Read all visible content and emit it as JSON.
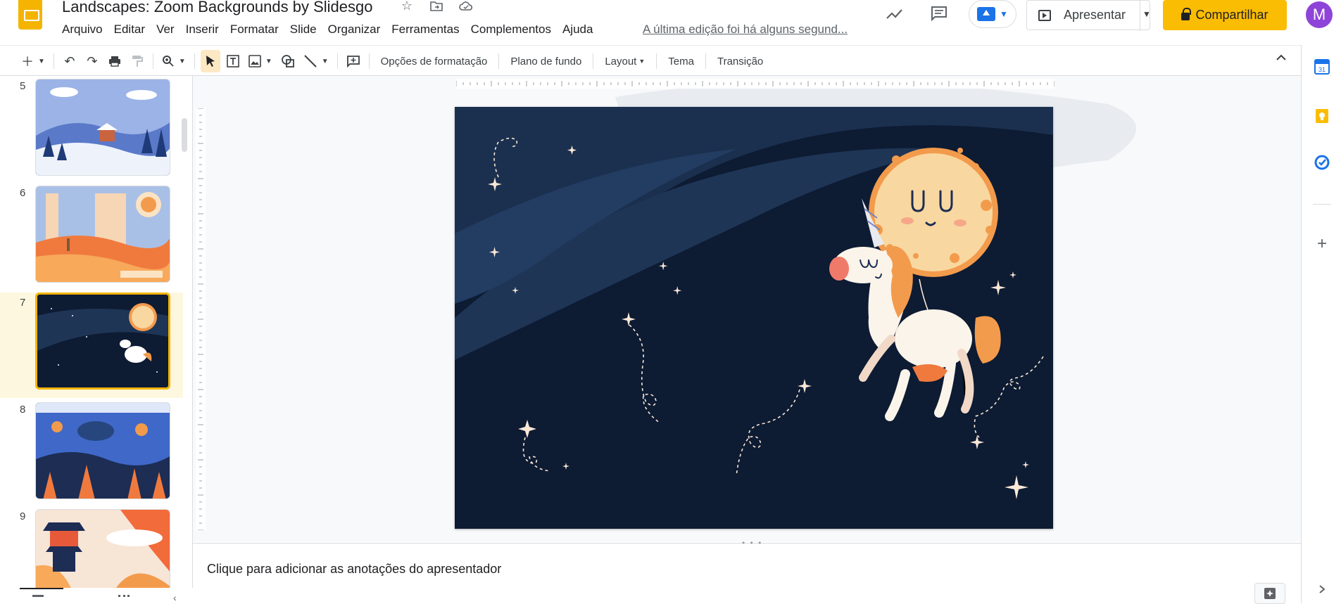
{
  "doc": {
    "title": "Landscapes: Zoom Backgrounds by Slidesgo",
    "last_edit": "A última edição foi há alguns segund..."
  },
  "menu": [
    "Arquivo",
    "Editar",
    "Ver",
    "Inserir",
    "Formatar",
    "Slide",
    "Organizar",
    "Ferramentas",
    "Complementos",
    "Ajuda"
  ],
  "header": {
    "present_label": "Apresentar",
    "share_label": "Compartilhar",
    "avatar_initial": "M",
    "share_color": "#fbbc04",
    "avatar_color": "#8e44d8"
  },
  "toolbar": {
    "format_options": "Opções de formatação",
    "background": "Plano de fundo",
    "layout": "Layout",
    "theme": "Tema",
    "transition": "Transição"
  },
  "filmstrip": {
    "slides": [
      {
        "num": "5"
      },
      {
        "num": "6"
      },
      {
        "num": "7",
        "active": true
      },
      {
        "num": "8"
      },
      {
        "num": "9"
      }
    ],
    "active_color": "#f4b400"
  },
  "notes": {
    "placeholder": "Clique para adicionar as anotações do apresentador"
  },
  "icons": {
    "star": "star-icon",
    "move": "folder-move-icon",
    "cloud": "cloud-saved-icon",
    "activity": "trending-up-icon",
    "comments": "comment-icon",
    "calendar": "calendar-icon",
    "keep": "keep-icon",
    "tasks": "tasks-icon",
    "addon": "plus-icon"
  },
  "colors": {
    "slide_bg": "#0d1b33",
    "moon": "#f8d8a0",
    "accent": "#f4b400"
  }
}
